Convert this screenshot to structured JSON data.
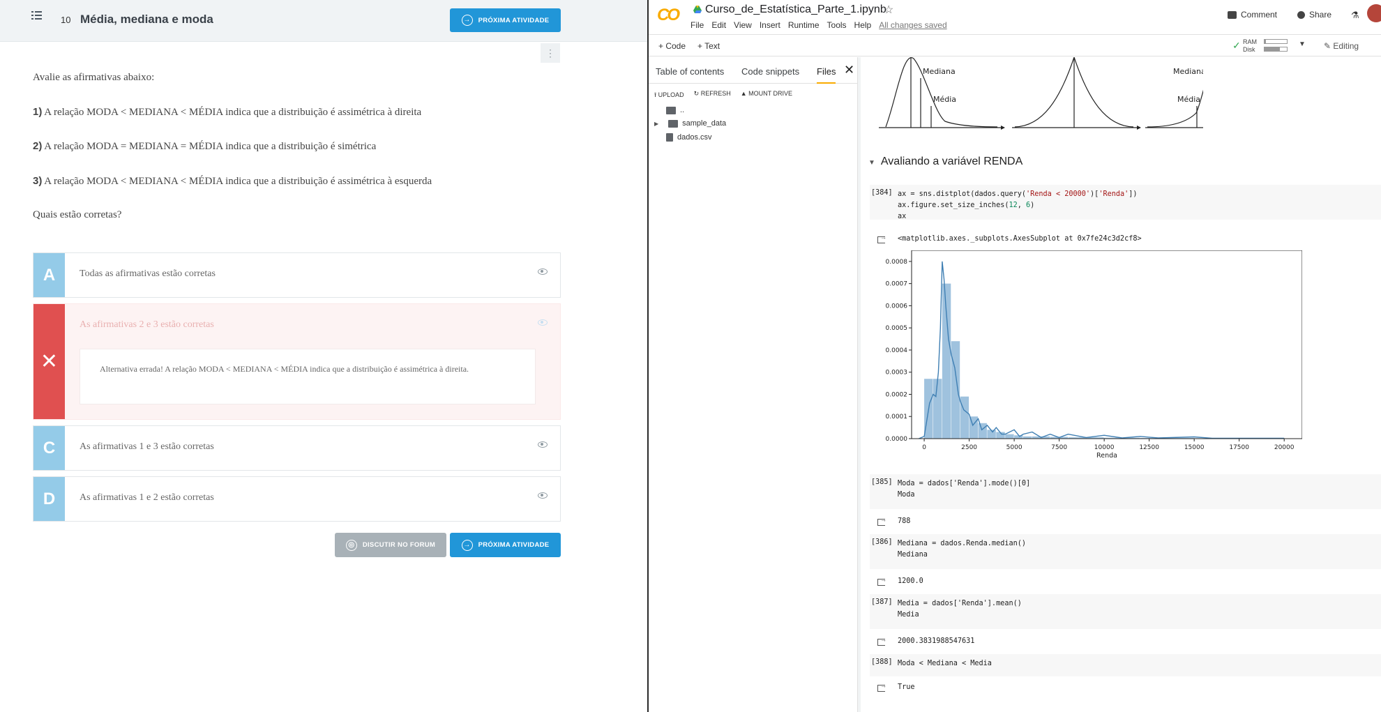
{
  "left": {
    "lesson_number": "10",
    "lesson_title": "Média, mediana e moda",
    "next_button": "PRÓXIMA ATIVIDADE",
    "forum_button": "DISCUTIR NO FORUM",
    "prompt_intro": "Avalie as afirmativas abaixo:",
    "statements": [
      {
        "num": "1)",
        "text": " A relação MODA < MEDIANA < MÉDIA indica que a distribuição é assimétrica à direita"
      },
      {
        "num": "2)",
        "text": " A relação MODA = MEDIANA = MÉDIA indica que a distribuição é simétrica"
      },
      {
        "num": "3)",
        "text": " A relação MODA < MEDIANA < MÉDIA indica que a distribuição é assimétrica à esquerda"
      }
    ],
    "question": "Quais estão corretas?",
    "alternatives": [
      {
        "letter": "A",
        "text": "Todas as afirmativas estão corretas"
      },
      {
        "letter": "✕",
        "text": "As afirmativas 2 e 3 estão corretas",
        "feedback": "Alternativa errada! A relação MODA < MEDIANA < MÉDIA indica que a distribuição é assimétrica à direita."
      },
      {
        "letter": "C",
        "text": "As afirmativas 1 e 3 estão corretas"
      },
      {
        "letter": "D",
        "text": "As afirmativas 1 e 2 estão corretas"
      }
    ]
  },
  "colab": {
    "logo": "CO",
    "notebook_title": "Curso_de_Estatística_Parte_1.ipynb",
    "menu": [
      "File",
      "Edit",
      "View",
      "Insert",
      "Runtime",
      "Tools",
      "Help"
    ],
    "saved_status": "All changes saved",
    "comment": "Comment",
    "share": "Share",
    "add_code": "+ Code",
    "add_text": "+ Text",
    "ram_label": "RAM",
    "disk_label": "Disk",
    "ram_fill": 0.05,
    "disk_fill": 0.7,
    "editing": "Editing",
    "sidebar": {
      "tabs": [
        "Table of contents",
        "Code snippets",
        "Files"
      ],
      "active_tab": "Files",
      "actions": [
        "UPLOAD",
        "REFRESH",
        "MOUNT DRIVE"
      ],
      "files": [
        "..",
        "sample_data",
        "dados.csv"
      ]
    },
    "figure_labels": {
      "mediana_left": "Mediana",
      "media_left": "Média",
      "mediana_right": "Mediana",
      "media_right": "Média"
    },
    "section_title": "Avaliando a variável RENDA",
    "cells": [
      {
        "prompt": "[384]",
        "out": "<matplotlib.axes._subplots.AxesSubplot at 0x7fe24c3d2cf8>"
      },
      {
        "prompt": "[385]",
        "line1": "Moda = dados['Renda'].mode()[0]",
        "line2": "Moda",
        "out": "788"
      },
      {
        "prompt": "[386]",
        "line1": "Mediana = dados.Renda.median()",
        "line2": "Mediana",
        "out": "1200.0"
      },
      {
        "prompt": "[387]",
        "line1": "Media = dados['Renda'].mean()",
        "line2": "Media",
        "out": "2000.3831988547631"
      },
      {
        "prompt": "[388]",
        "line1": "Moda < Mediana < Media",
        "out": "True"
      }
    ]
  },
  "chart_data": {
    "type": "histogram",
    "xlabel": "Renda",
    "ylabel": "",
    "xlim": [
      -700,
      21000
    ],
    "ylim": [
      0,
      0.00085
    ],
    "xticks": [
      0,
      2500,
      5000,
      7500,
      10000,
      12500,
      15000,
      17500,
      20000
    ],
    "yticks": [
      0.0,
      0.0001,
      0.0002,
      0.0003,
      0.0004,
      0.0005,
      0.0006,
      0.0007,
      0.0008
    ],
    "ytick_labels": [
      "0.0000",
      "0.0001",
      "0.0002",
      "0.0003",
      "0.0004",
      "0.0005",
      "0.0006",
      "0.0007",
      "0.0008"
    ],
    "bins": [
      {
        "x0": 0,
        "x1": 500,
        "density": 0.00027
      },
      {
        "x0": 500,
        "x1": 1000,
        "density": 0.00027
      },
      {
        "x0": 1000,
        "x1": 1500,
        "density": 0.0007
      },
      {
        "x0": 1500,
        "x1": 2000,
        "density": 0.00044
      },
      {
        "x0": 2000,
        "x1": 2500,
        "density": 0.00019
      },
      {
        "x0": 2500,
        "x1": 3000,
        "density": 0.0001
      },
      {
        "x0": 3000,
        "x1": 3500,
        "density": 7e-05
      },
      {
        "x0": 3500,
        "x1": 4000,
        "density": 4e-05
      },
      {
        "x0": 4000,
        "x1": 4500,
        "density": 3e-05
      },
      {
        "x0": 4500,
        "x1": 5000,
        "density": 2e-05
      },
      {
        "x0": 5000,
        "x1": 5500,
        "density": 1.5e-05
      },
      {
        "x0": 5500,
        "x1": 6000,
        "density": 1e-05
      },
      {
        "x0": 6000,
        "x1": 7000,
        "density": 1e-05
      },
      {
        "x0": 7000,
        "x1": 8000,
        "density": 8e-06
      },
      {
        "x0": 8000,
        "x1": 10000,
        "density": 6e-06
      },
      {
        "x0": 10000,
        "x1": 12000,
        "density": 4e-06
      },
      {
        "x0": 12000,
        "x1": 15000,
        "density": 3e-06
      },
      {
        "x0": 15000,
        "x1": 20000,
        "density": 2e-06
      }
    ],
    "kde": [
      [
        -300,
        0.0
      ],
      [
        0,
        1e-05
      ],
      [
        300,
        0.00016
      ],
      [
        500,
        0.0002
      ],
      [
        650,
        0.00019
      ],
      [
        788,
        0.0003
      ],
      [
        900,
        0.0005
      ],
      [
        1000,
        0.0008
      ],
      [
        1100,
        0.00072
      ],
      [
        1200,
        0.0006
      ],
      [
        1350,
        0.00045
      ],
      [
        1500,
        0.00038
      ],
      [
        1700,
        0.00032
      ],
      [
        1900,
        0.0002
      ],
      [
        2000,
        0.00017
      ],
      [
        2200,
        0.00013
      ],
      [
        2500,
        0.00011
      ],
      [
        2700,
        6e-05
      ],
      [
        3000,
        9e-05
      ],
      [
        3200,
        4e-05
      ],
      [
        3500,
        6e-05
      ],
      [
        3800,
        3e-05
      ],
      [
        4000,
        5e-05
      ],
      [
        4300,
        2e-05
      ],
      [
        4500,
        2e-05
      ],
      [
        5000,
        4e-05
      ],
      [
        5300,
        1e-05
      ],
      [
        5500,
        2e-05
      ],
      [
        6000,
        3e-05
      ],
      [
        6500,
        5e-06
      ],
      [
        7000,
        2e-05
      ],
      [
        7500,
        5e-06
      ],
      [
        8000,
        2e-05
      ],
      [
        9000,
        5e-06
      ],
      [
        10000,
        1.5e-05
      ],
      [
        11000,
        3e-06
      ],
      [
        12000,
        1e-05
      ],
      [
        13000,
        3e-06
      ],
      [
        15000,
        8e-06
      ],
      [
        16000,
        2e-06
      ],
      [
        18000,
        2e-06
      ],
      [
        20000,
        2e-06
      ]
    ]
  }
}
